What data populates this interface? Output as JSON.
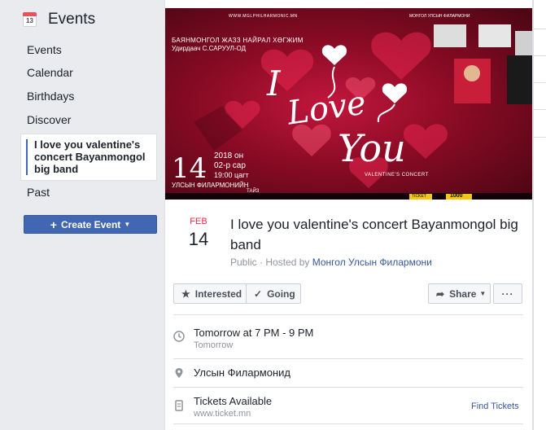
{
  "sidebar": {
    "header_title": "Events",
    "calendar_day": "13",
    "items": [
      {
        "label": "Events"
      },
      {
        "label": "Calendar"
      },
      {
        "label": "Birthdays"
      },
      {
        "label": "Discover"
      },
      {
        "label": "I love you valentine's concert Bayanmongol big band"
      },
      {
        "label": "Past"
      }
    ],
    "create_button": "Create Event"
  },
  "event": {
    "month": "FEB",
    "day": "14",
    "title": "I love you valentine's concert Bayanmongol big band",
    "privacy": "Public",
    "hosted_by_prefix": "Hosted by",
    "host": "Монгол Улсын Филармони",
    "separator": " · "
  },
  "actions": {
    "interested": "Interested",
    "going": "Going",
    "share": "Share",
    "more": "···"
  },
  "details": {
    "time_main": "Tomorrow at 7 PM - 9 PM",
    "time_sub": "Tomorrow",
    "location": "Улсын Филармонид",
    "tickets_main": "Tickets Available",
    "tickets_sub": "www.ticket.mn",
    "find_tickets": "Find Tickets"
  },
  "poster": {
    "website": "WWW.MGLPHILHARMONIC.MN",
    "org": "МОНГОЛ УЛСЫН ФИЛАРМОНИ",
    "line1": "БАЯНМОНГОЛ ЖАЗЗ НАЙРАЛ ХӨГЖИМ",
    "line2": "Удирдаач С.САРУУЛ-ОД",
    "script_1": "I",
    "script_2": "Love",
    "script_3": "You",
    "date_big": "14",
    "date_year": "2018 он",
    "date_month": "02-р сар",
    "date_time": "19:00 цагт",
    "venue": "УЛСЫН ФИЛАРМОНИЙН",
    "hall": "ТАЙЗ",
    "subtitle": "VALENTINE'S CONCERT",
    "ticket_label": "TICKET",
    "price": "1000"
  },
  "colors": {
    "brand": "#4267b2",
    "link": "#365899",
    "month": "#f02849",
    "muted": "#90949c"
  }
}
